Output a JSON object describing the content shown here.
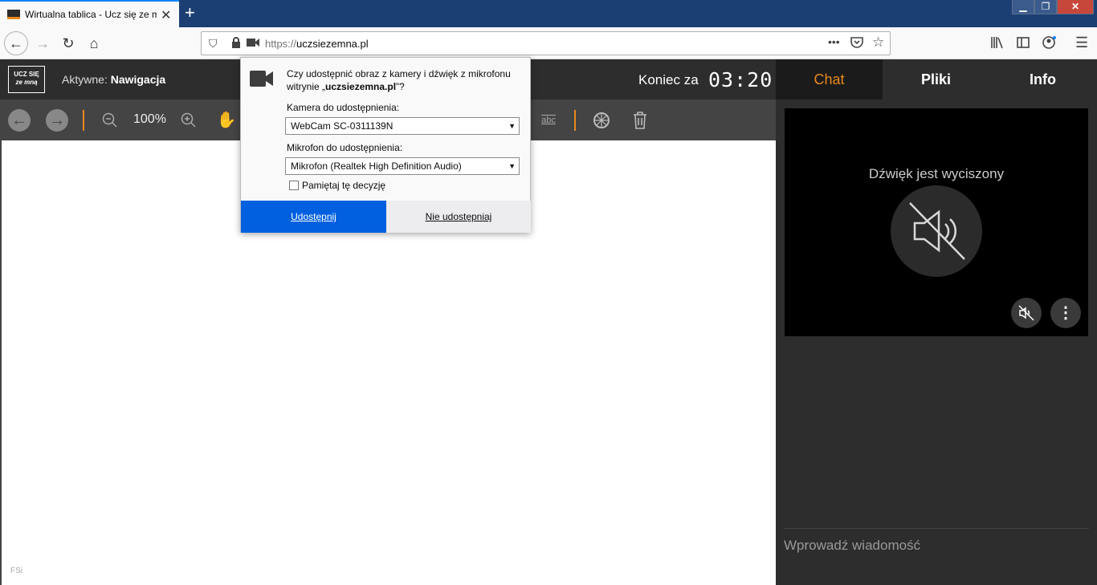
{
  "browser": {
    "tab_title": "Wirtualna tablica - Ucz się ze m",
    "tab_close": "✕",
    "new_tab": "+",
    "url_scheme": "https://",
    "url_host": "uczsiezemna.pl",
    "window_min": "▁",
    "window_max": "❐",
    "window_close": "✕"
  },
  "app": {
    "logo_line1": "UCZ SIĘ",
    "logo_line2": "ze mną",
    "active_prefix": "Aktywne:",
    "active_value": "Nawigacja",
    "end_label": "Koniec za",
    "end_time": "03:20",
    "zoom": "100%",
    "watermark": "FSi"
  },
  "right_panel": {
    "tabs": [
      "Chat",
      "Pliki",
      "Info"
    ],
    "muted_text": "Dźwięk jest wyciszony",
    "chat_placeholder": "Wprowadź wiadomość"
  },
  "popup": {
    "question_a": "Czy udostępnić obraz z kamery i dźwięk z mikrofonu witrynie „",
    "question_site": "uczsiezemna.pl",
    "question_b": "”?",
    "camera_label": "Kamera do udostępnienia:",
    "camera_value": "WebCam SC-0311139N",
    "mic_label": "Mikrofon do udostępnienia:",
    "mic_value": "Mikrofon (Realtek High Definition Audio)",
    "remember_label": "Pamiętaj tę decyzję",
    "remember_checked": false,
    "share_button": "Udostępnij",
    "noshare_button": "Nie udostępniaj"
  },
  "colors": {
    "accent": "#e8891e",
    "primary_button": "#0060df",
    "tabbar": "#1b3f73"
  }
}
